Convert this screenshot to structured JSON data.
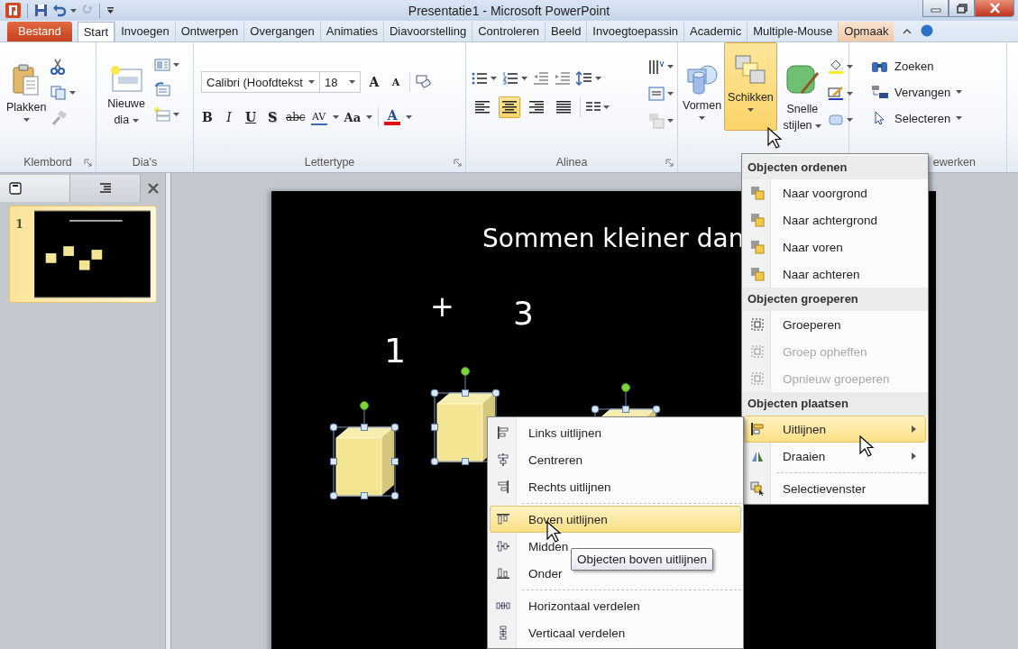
{
  "window": {
    "title": "Presentatie1 - Microsoft PowerPoint"
  },
  "tabs": [
    {
      "label": "Bestand",
      "kind": "file",
      "selected": false
    },
    {
      "label": "Start",
      "kind": "tab",
      "selected": true
    },
    {
      "label": "Invoegen",
      "kind": "tab",
      "selected": false
    },
    {
      "label": "Ontwerpen",
      "kind": "tab",
      "selected": false
    },
    {
      "label": "Overgangen",
      "kind": "tab",
      "selected": false
    },
    {
      "label": "Animaties",
      "kind": "tab",
      "selected": false
    },
    {
      "label": "Diavoorstelling",
      "kind": "tab",
      "selected": false
    },
    {
      "label": "Controleren",
      "kind": "tab",
      "selected": false
    },
    {
      "label": "Beeld",
      "kind": "tab",
      "selected": false
    },
    {
      "label": "Invoegtoepassin",
      "kind": "tab",
      "selected": false
    },
    {
      "label": "Academic",
      "kind": "tab",
      "selected": false
    },
    {
      "label": "Multiple-Mouse",
      "kind": "tab",
      "selected": false
    },
    {
      "label": "Opmaak",
      "kind": "contextual",
      "selected": false
    }
  ],
  "ribbon": {
    "clipboard": {
      "paste": "Plakken",
      "label": "Klembord"
    },
    "slides": {
      "new_slide": "Nieuwe dia",
      "label": "Dia's"
    },
    "font": {
      "family": "Calibri (Hoofdtekst",
      "size": "18",
      "size_buttons": [
        {
          "text": "A",
          "kind": "grow"
        },
        {
          "text": "A",
          "kind": "shrink"
        }
      ],
      "styles": [
        {
          "text": "B",
          "kind": "bold"
        },
        {
          "text": "I",
          "kind": "italic"
        },
        {
          "text": "U",
          "kind": "underline"
        },
        {
          "text": "S",
          "kind": "shadow"
        },
        {
          "text": "abc",
          "kind": "strike"
        },
        {
          "text": "AV",
          "kind": "spacing"
        },
        {
          "text": "Aa",
          "kind": "case"
        },
        {
          "text": "A",
          "kind": "color"
        }
      ],
      "label": "Lettertype"
    },
    "paragraph": {
      "alignment": [
        {
          "selected": false
        },
        {
          "selected": true
        },
        {
          "selected": false
        },
        {
          "selected": false
        }
      ],
      "label": "Alinea"
    },
    "drawing": {
      "shapes": "Vormen",
      "arrange": {
        "label": "Schikken",
        "open": true
      },
      "quick_styles": "Snelle stijlen"
    },
    "editing": {
      "find": "Zoeken",
      "replace": "Vervangen",
      "select": "Selecteren",
      "label": "ewerken"
    }
  },
  "slides_pane": {
    "slides": [
      {
        "number": "1",
        "selected": true
      }
    ]
  },
  "slide": {
    "title": "Sommen kleiner dan",
    "texts": [
      "1",
      "+",
      "3"
    ],
    "cubes": [
      {
        "selected": true
      },
      {
        "selected": true
      },
      {
        "selected": true
      }
    ]
  },
  "arrange_menu": {
    "sections": [
      {
        "heading": "Objecten ordenen",
        "groups": [
          [
            {
              "label": "Naar voorgrond",
              "disabled": false,
              "selected": false,
              "submenu": false
            },
            {
              "label": "Naar achtergrond",
              "disabled": false,
              "selected": false,
              "submenu": false
            },
            {
              "label": "Naar voren",
              "disabled": false,
              "selected": false,
              "submenu": false
            },
            {
              "label": "Naar achteren",
              "disabled": false,
              "selected": false,
              "submenu": false
            }
          ]
        ]
      },
      {
        "heading": "Objecten groeperen",
        "groups": [
          [
            {
              "label": "Groeperen",
              "disabled": false,
              "selected": false,
              "submenu": false
            },
            {
              "label": "Groep opheffen",
              "disabled": true,
              "selected": false,
              "submenu": false
            },
            {
              "label": "Opnieuw groeperen",
              "disabled": true,
              "selected": false,
              "submenu": false
            }
          ]
        ]
      },
      {
        "heading": "Objecten plaatsen",
        "groups": [
          [
            {
              "label": "Uitlijnen",
              "disabled": false,
              "selected": true,
              "submenu": true
            },
            {
              "label": "Draaien",
              "disabled": false,
              "selected": false,
              "submenu": true
            }
          ],
          [
            {
              "label": "Selectievenster",
              "disabled": false,
              "selected": false,
              "submenu": false
            }
          ]
        ]
      }
    ]
  },
  "align_menu": {
    "groups": [
      [
        {
          "label": "Links uitlijnen",
          "selected": false
        },
        {
          "label": "Centreren",
          "selected": false
        },
        {
          "label": "Rechts uitlijnen",
          "selected": false
        }
      ],
      [
        {
          "label": "Boven uitlijnen",
          "selected": true
        },
        {
          "label": "Midden",
          "selected": false
        },
        {
          "label": "Onder",
          "selected": false
        }
      ],
      [
        {
          "label": "Horizontaal verdelen",
          "selected": false
        },
        {
          "label": "Verticaal verdelen",
          "selected": false
        }
      ]
    ]
  },
  "tooltip": {
    "text": "Objecten boven uitlijnen"
  }
}
